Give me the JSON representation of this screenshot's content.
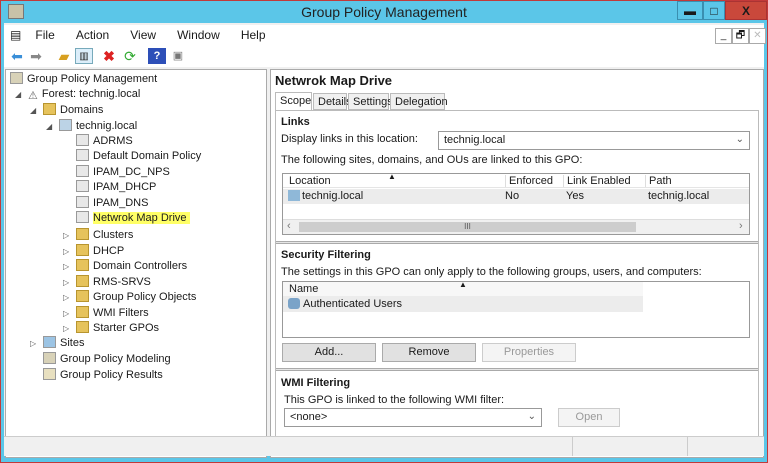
{
  "window": {
    "title": "Group Policy Management",
    "minimize": "▬",
    "maximize": "□",
    "close": "X"
  },
  "menu": {
    "items": [
      "File",
      "Action",
      "View",
      "Window",
      "Help"
    ],
    "mdi": [
      "_",
      "🗗",
      "✕"
    ]
  },
  "toolbar": {
    "icons": [
      "back-icon",
      "forward-icon",
      "up-folder-icon",
      "show-hide-tree-icon",
      "delete-icon",
      "refresh-icon",
      "help-icon",
      "action-pane-icon"
    ]
  },
  "tree": {
    "root": "Group Policy Management",
    "forest": "Forest: technig.local",
    "domains": "Domains",
    "domain": "technig.local",
    "gpos": [
      "ADRMS",
      "Default Domain Policy",
      "IPAM_DC_NPS",
      "IPAM_DHCP",
      "IPAM_DNS",
      "Netwrok Map Drive"
    ],
    "ous": [
      "Clusters",
      "DHCP",
      "Domain Controllers",
      "RMS-SRVS",
      "Group Policy Objects",
      "WMI Filters",
      "Starter GPOs"
    ],
    "sites": "Sites",
    "modeling": "Group Policy Modeling",
    "results": "Group Policy Results"
  },
  "detail": {
    "title": "Netwrok Map Drive",
    "tabs": [
      "Scope",
      "Details",
      "Settings",
      "Delegation"
    ],
    "links": {
      "heading": "Links",
      "display_label": "Display links in this location:",
      "display_value": "technig.local",
      "linked_label": "The following sites, domains, and OUs are linked to this GPO:",
      "columns": [
        "Location",
        "Enforced",
        "Link Enabled",
        "Path"
      ],
      "rows": [
        [
          "technig.local",
          "No",
          "Yes",
          "technig.local"
        ]
      ],
      "scroll_grip": "III"
    },
    "security": {
      "heading": "Security Filtering",
      "desc": "The settings in this GPO can only apply to the following groups, users, and computers:",
      "column": "Name",
      "rows": [
        "Authenticated Users"
      ],
      "add": "Add...",
      "remove": "Remove",
      "properties": "Properties"
    },
    "wmi": {
      "heading": "WMI Filtering",
      "desc": "This GPO is linked to the following WMI filter:",
      "value": "<none>",
      "open": "Open"
    }
  }
}
